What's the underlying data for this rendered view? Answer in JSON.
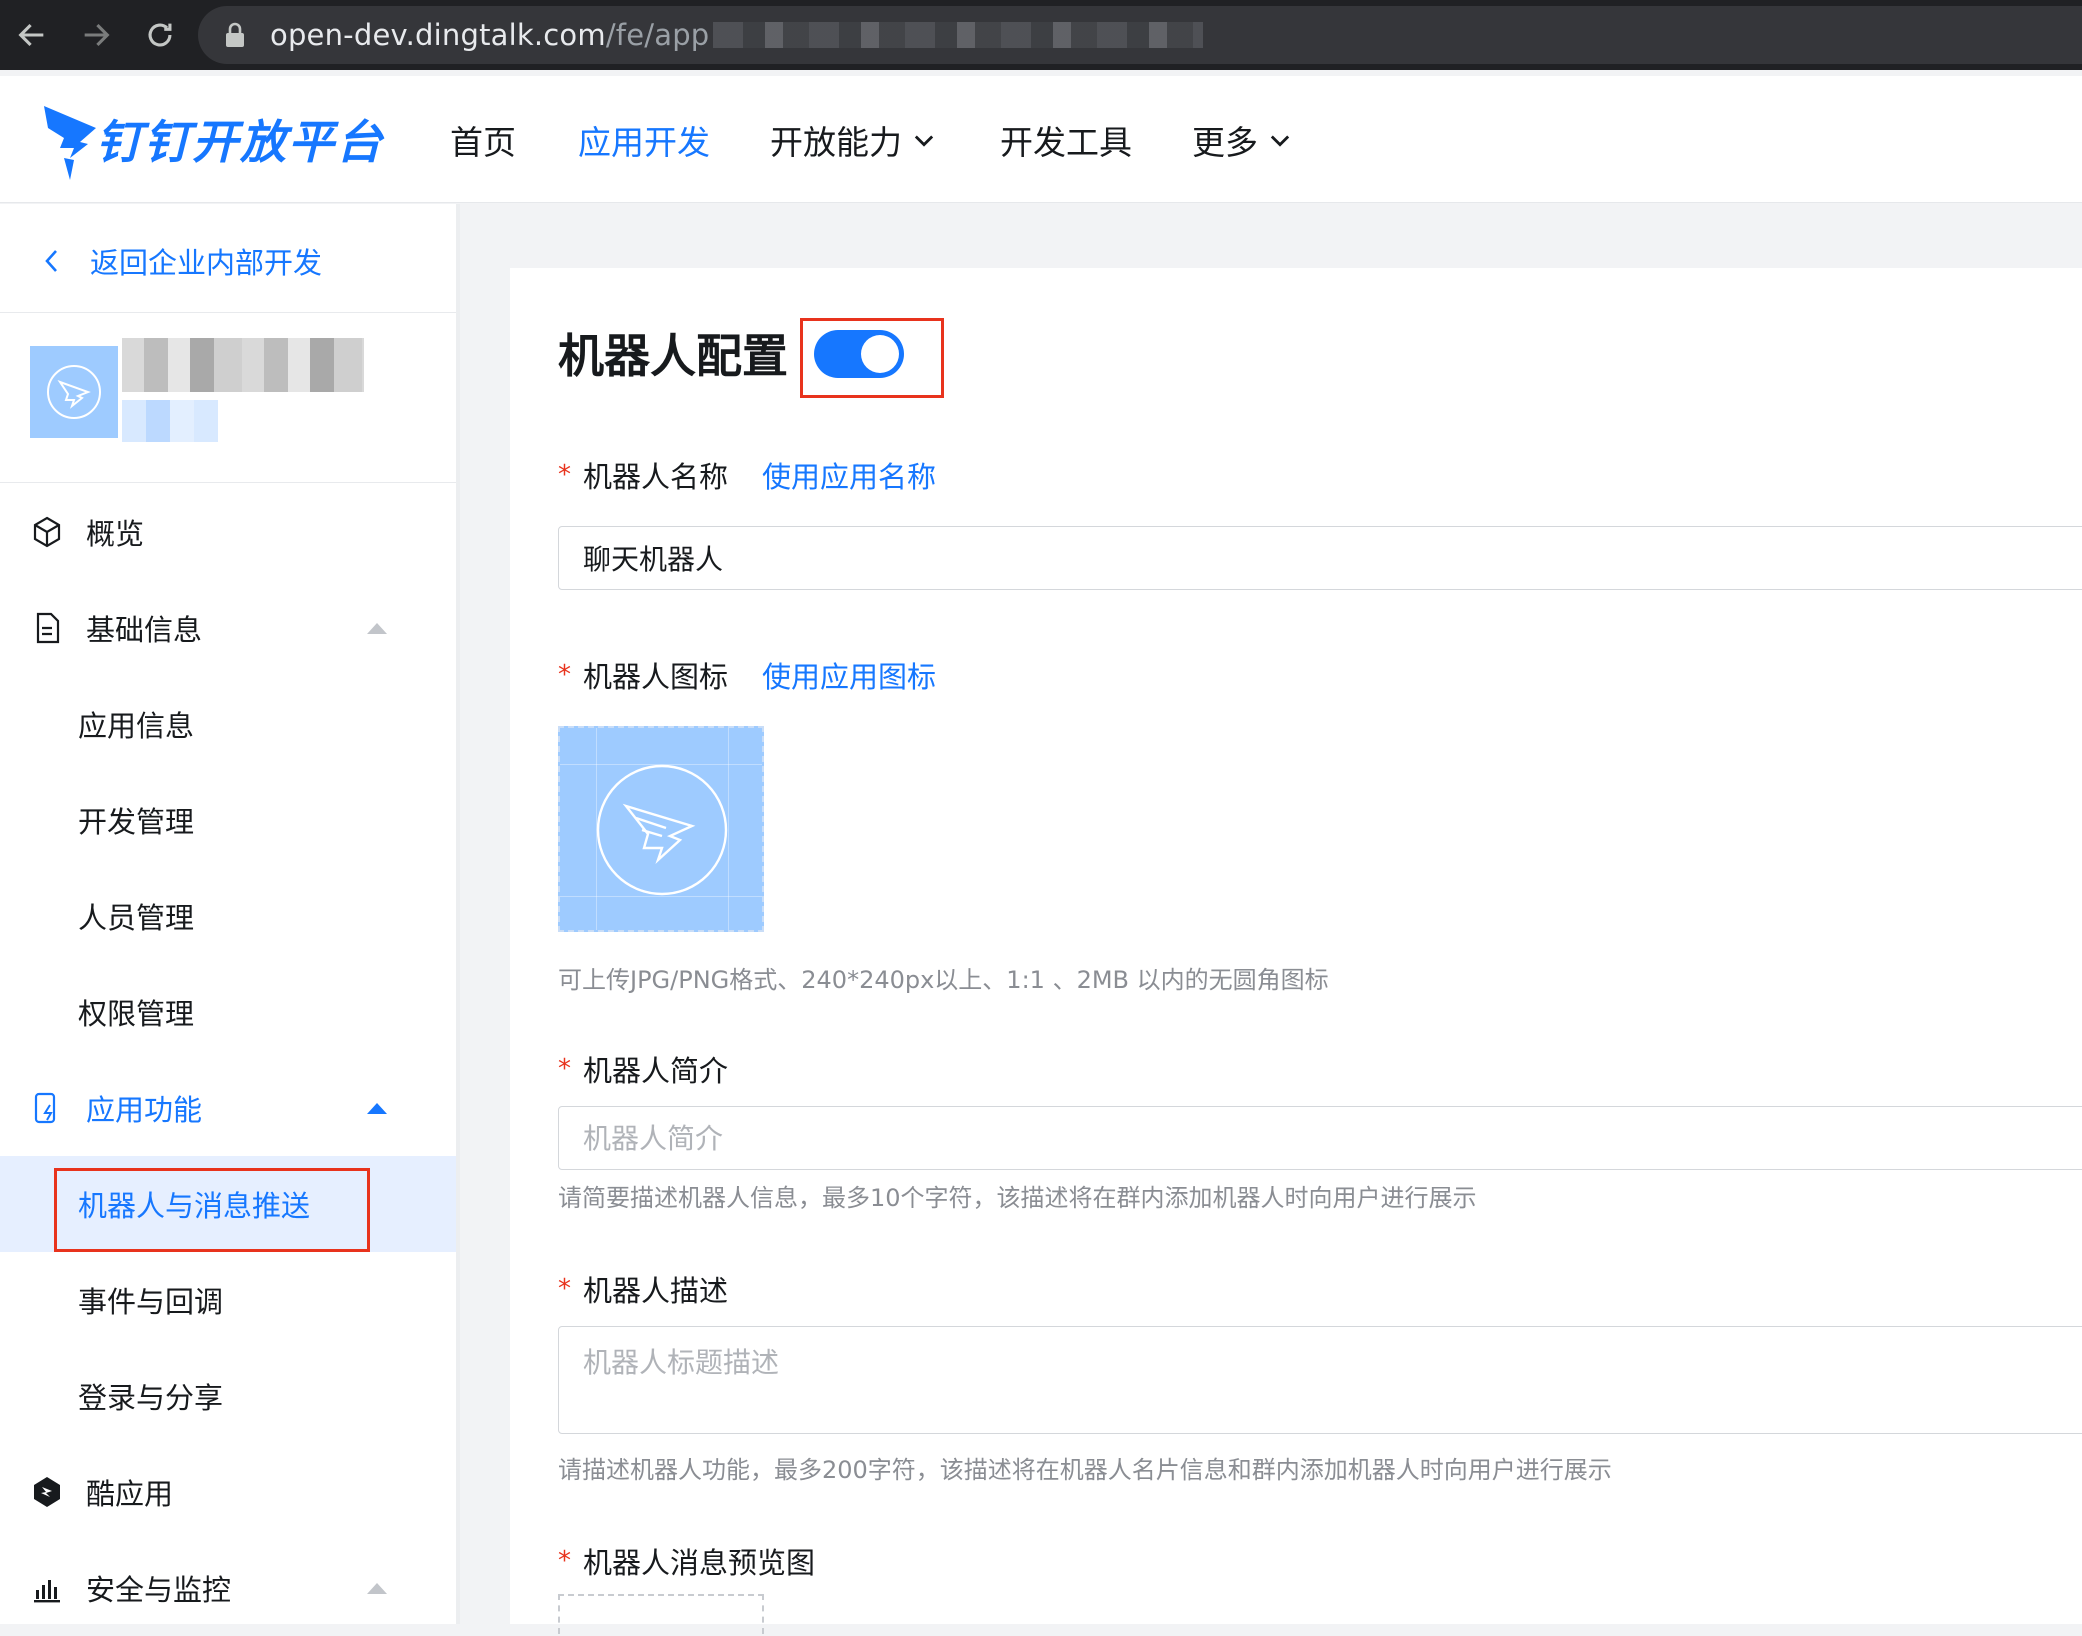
{
  "browser": {
    "url_host": "open-dev.dingtalk.com",
    "url_path": "/fe/app"
  },
  "header": {
    "logo_text": "钉钉开放平台",
    "nav": [
      {
        "label": "首页"
      },
      {
        "label": "应用开发"
      },
      {
        "label": "开放能力"
      },
      {
        "label": "开发工具"
      },
      {
        "label": "更多"
      }
    ],
    "active_nav": "应用开发",
    "accent_color": "#1677ff"
  },
  "sidebar": {
    "back_label": "返回企业内部开发",
    "items": [
      {
        "label": "概览",
        "icon": "cube-icon"
      },
      {
        "label": "基础信息",
        "icon": "document-icon",
        "expanded": true
      },
      {
        "label": "应用信息"
      },
      {
        "label": "开发管理"
      },
      {
        "label": "人员管理"
      },
      {
        "label": "权限管理"
      },
      {
        "label": "应用功能",
        "icon": "app-function-icon",
        "expanded": true
      },
      {
        "label": "机器人与消息推送",
        "selected": true
      },
      {
        "label": "事件与回调"
      },
      {
        "label": "登录与分享"
      },
      {
        "label": "酷应用",
        "icon": "cool-app-icon"
      },
      {
        "label": "安全与监控",
        "icon": "bar-chart-icon",
        "expanded": true
      }
    ]
  },
  "main": {
    "title": "机器人配置",
    "toggle_on": true,
    "fields": {
      "name": {
        "label": "机器人名称",
        "link": "使用应用名称",
        "value": "聊天机器人"
      },
      "icon": {
        "label": "机器人图标",
        "link": "使用应用图标",
        "hint": "可上传JPG/PNG格式、240*240px以上、1:1 、2MB 以内的无圆角图标"
      },
      "intro": {
        "label": "机器人简介",
        "placeholder": "机器人简介",
        "hint": "请简要描述机器人信息，最多10个字符，该描述将在群内添加机器人时向用户进行展示"
      },
      "description": {
        "label": "机器人描述",
        "placeholder": "机器人标题描述",
        "hint": "请描述机器人功能，最多200字符，该描述将在机器人名片信息和群内添加机器人时向用户进行展示"
      },
      "preview": {
        "label": "机器人消息预览图"
      }
    },
    "required_mark": "*"
  }
}
